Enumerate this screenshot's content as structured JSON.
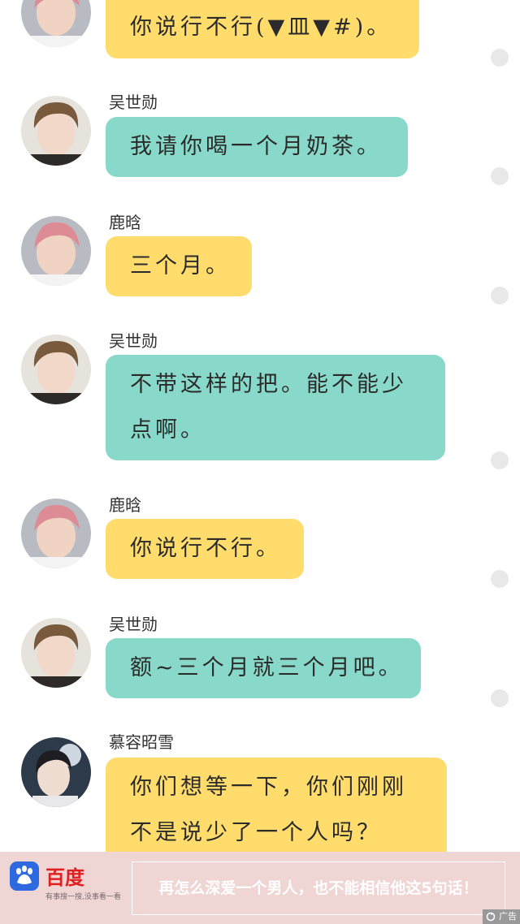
{
  "messages": [
    {
      "sender": "",
      "text": [
        "你说行不行(▼皿▼#)。"
      ],
      "color": "yellow",
      "avatar": "pink-hair-avatar"
    },
    {
      "sender": "吴世勋",
      "text": [
        "我请你喝一个月奶茶。"
      ],
      "color": "teal",
      "avatar": "brown-hair-avatar"
    },
    {
      "sender": "鹿晗",
      "text": [
        "三个月。"
      ],
      "color": "yellow",
      "avatar": "pink-hair-avatar"
    },
    {
      "sender": "吴世勋",
      "text": [
        "不带这样的把。能不能少",
        "点啊。"
      ],
      "color": "teal",
      "avatar": "brown-hair-avatar"
    },
    {
      "sender": "鹿晗",
      "text": [
        "你说行不行。"
      ],
      "color": "yellow",
      "avatar": "pink-hair-avatar"
    },
    {
      "sender": "吴世勋",
      "text": [
        "额~三个月就三个月吧。"
      ],
      "color": "teal",
      "avatar": "brown-hair-avatar"
    },
    {
      "sender": "慕容昭雪",
      "text": [
        "你们想等一下，你们刚刚",
        "不是说少了一个人吗？"
      ],
      "color": "yellow",
      "avatar": "girl-avatar"
    }
  ],
  "colors": {
    "yellow_bubble": "#ffdc6b",
    "teal_bubble": "#88d9ca",
    "ad_background": "#f0d5d5",
    "baidu_blue": "#2e69e0",
    "baidu_red": "#e02020"
  },
  "ad": {
    "logo_text": "百度",
    "slogan": "有事搜一搜,没事看一看",
    "headline": "再怎么深爱一个男人，也不能相信他这5句话！",
    "tag": "广告"
  }
}
